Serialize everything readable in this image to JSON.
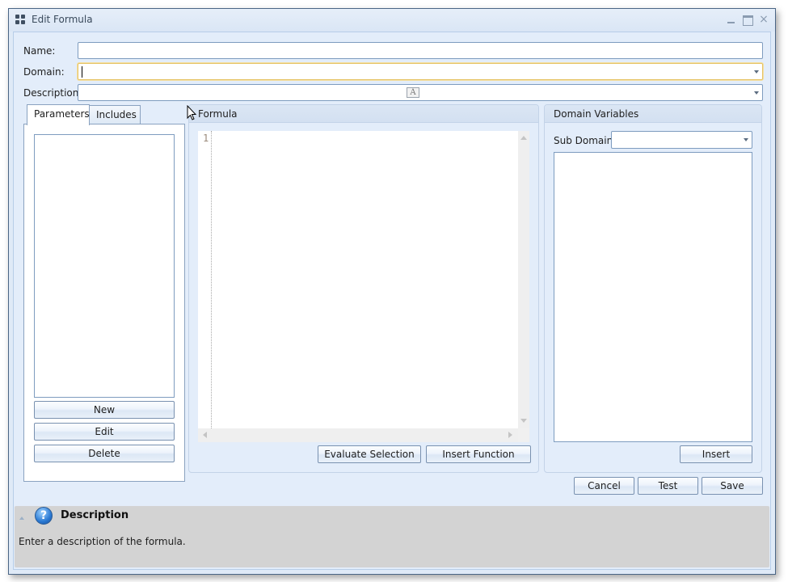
{
  "window": {
    "title": "Edit Formula",
    "controls": {
      "minimize": "minimize",
      "maximize": "maximize",
      "close": "×"
    }
  },
  "form": {
    "name": {
      "label": "Name:",
      "value": "",
      "placeholder": ""
    },
    "domain": {
      "label": "Domain:",
      "value": "",
      "focused": true
    },
    "description": {
      "label": "Description:",
      "value": "",
      "spellcheck_icon": "A"
    }
  },
  "left_panel": {
    "tabs": [
      {
        "label": "Parameters",
        "active": true
      },
      {
        "label": "Includes",
        "active": false
      }
    ],
    "buttons": {
      "new": "New",
      "edit": "Edit",
      "delete": "Delete"
    }
  },
  "formula_panel": {
    "title": "Formula",
    "line_numbers": [
      "1"
    ],
    "content": "",
    "buttons": {
      "evaluate_selection": "Evaluate Selection",
      "insert_function": "Insert Function"
    }
  },
  "domain_variables_panel": {
    "title": "Domain Variables",
    "sub_domain_label": "Sub Domain:",
    "sub_domain_value": "",
    "items": [],
    "insert_button": "Insert"
  },
  "dialog_buttons": {
    "cancel": "Cancel",
    "test": "Test",
    "save": "Save"
  },
  "description_pane": {
    "title": "Description",
    "help_icon": "?",
    "text": "Enter a description of the formula."
  }
}
